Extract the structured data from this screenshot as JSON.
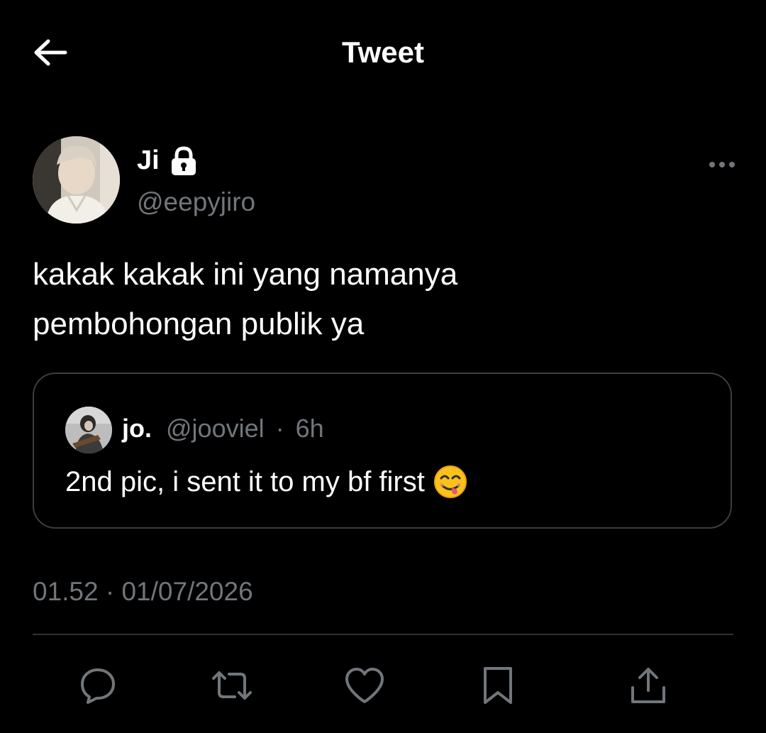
{
  "header": {
    "title": "Tweet",
    "back_icon": "arrow-left-icon"
  },
  "author": {
    "name": "Ji",
    "handle": "@eepyjiro",
    "protected_icon": "lock-icon",
    "more_icon": "more-horizontal-icon"
  },
  "tweet": {
    "lines": [
      "kakak kakak ini yang namanya",
      "pembohongan publik ya"
    ]
  },
  "quote": {
    "name": "jo.",
    "handle": "@jooviel",
    "separator": "·",
    "time": "6h",
    "text": "2nd pic, i sent it to my bf first",
    "emoji_icon": "face-savoring-food-emoji-icon"
  },
  "timestamp": {
    "time": "01.52",
    "separator": "·",
    "date": "01/07/2026"
  },
  "actions": {
    "icons": [
      "reply-icon",
      "retweet-icon",
      "like-icon",
      "bookmark-icon",
      "share-icon"
    ]
  },
  "colors": {
    "background": "#000000",
    "primary_text": "#ffffff",
    "secondary_text": "#71767b",
    "border": "#2f3336",
    "icon": "#71767b"
  }
}
